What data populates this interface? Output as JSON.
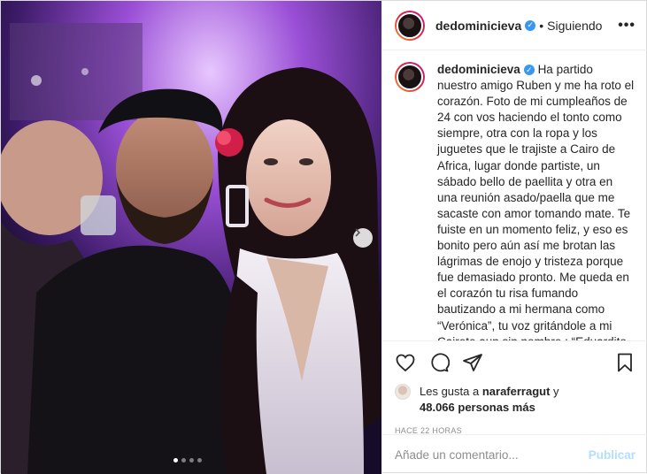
{
  "header": {
    "username": "dedominicieva",
    "separator": "•",
    "follow_status": "Siguiendo",
    "more": "•••"
  },
  "caption": {
    "username": "dedominicieva",
    "text": "Ha partido nuestro amigo Ruben y me ha roto el corazón. Foto de mi cumpleaños de 24 con vos haciendo el tonto como siempre, otra con la ropa y los juguetes que le trajiste a Cairo de Africa, lugar donde partiste, un sábado bello de paellita y otra en una reunión asado/paella que me sacaste con amor tomando mate. Te fuiste en un momento feliz, y eso es bonito pero aún así me brotan las lágrimas de enojo y tristeza porque fue demasiado pronto. Me queda en el corazón tu risa fumando bautizando a mi hermana como “Verónica”, tu voz gritándole a mi Cairete aun sin nombre : “Eduardito que soy tu tío Ruben” y por sobre todo nuestra charla del último hiking..."
  },
  "likes": {
    "prefix": "Les gusta a",
    "user": "naraferragut",
    "connector": "y",
    "others": "48.066 personas más"
  },
  "timestamp": "HACE 22 HORAS",
  "comment": {
    "placeholder": "Añade un comentario...",
    "publish_label": "Publicar"
  },
  "carousel": {
    "total_slides": 4,
    "active_slide": 1
  },
  "colors": {
    "verified": "#3897f0",
    "publish": "#b2dffc",
    "muted": "#8e8e8e"
  },
  "icons": [
    "heart-icon",
    "comment-icon",
    "share-icon",
    "bookmark-icon",
    "chevron-right-icon",
    "verified-icon",
    "more-icon"
  ]
}
